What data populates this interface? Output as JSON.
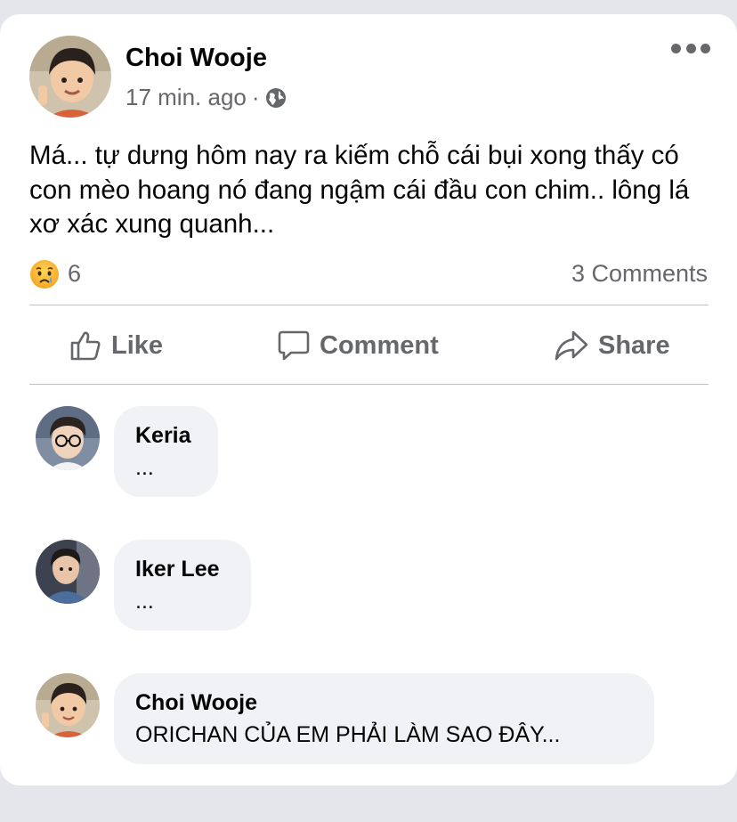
{
  "post": {
    "author": "Choi Wooje",
    "time": "17 min. ago",
    "separator": "·",
    "text": "Má... tự dưng hôm nay ra kiếm chỗ cái bụi xong thấy có con mèo hoang nó đang ngậm cái đầu con chim.. lông lá xơ xác xung quanh...",
    "reaction_icon": "sad-emoji-icon",
    "reaction_count": "6",
    "comments_count": "3 Comments"
  },
  "actions": {
    "like_label": "Like",
    "comment_label": "Comment",
    "share_label": "Share"
  },
  "comments": [
    {
      "name": "Keria",
      "text": "..."
    },
    {
      "name": "Iker Lee",
      "text": "..."
    },
    {
      "name": "Choi Wooje",
      "text": "ORICHAN CỦA EM PHẢI LÀM SAO ĐÂY..."
    }
  ],
  "colors": {
    "background": "#e4e6eb",
    "card": "#ffffff",
    "secondary_text": "#65676b",
    "bubble": "#f0f2f5"
  }
}
